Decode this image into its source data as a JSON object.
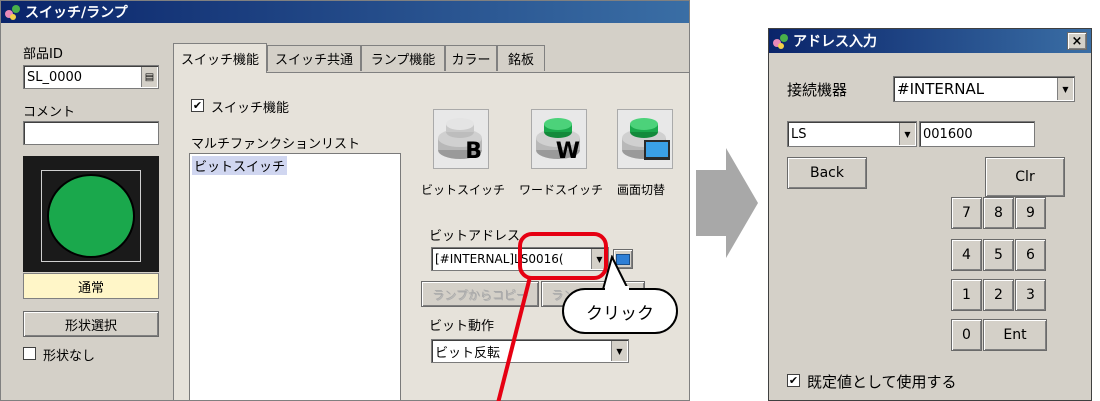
{
  "left_window": {
    "title": "スイッチ/ランプ",
    "part_id_label": "部品ID",
    "part_id_value": "SL_0000",
    "comment_label": "コメント",
    "comment_value": "",
    "preview_state": "通常",
    "shape_select_button": "形状選択",
    "no_shape_label": "形状なし",
    "no_shape_checked": false,
    "tabs": [
      {
        "label": "スイッチ機能",
        "active": true
      },
      {
        "label": "スイッチ共通",
        "active": false
      },
      {
        "label": "ランプ機能",
        "active": false
      },
      {
        "label": "カラー",
        "active": false
      },
      {
        "label": "銘板",
        "active": false
      }
    ],
    "switch_function_label": "スイッチ機能",
    "switch_function_checked": true,
    "multifunction_list_label": "マルチファンクションリスト",
    "multifunction_list_items": [
      "ビットスイッチ"
    ],
    "switch_types": [
      {
        "label": "ビットスイッチ",
        "letter": "B",
        "icon": "bit-switch-icon"
      },
      {
        "label": "ワードスイッチ",
        "letter": "W",
        "icon": "word-switch-icon"
      },
      {
        "label": "画面切替",
        "letter": "",
        "icon": "screen-change-icon"
      }
    ],
    "bit_address_label": "ビットアドレス",
    "bit_address_value": "[#INTERNAL]LS0016(",
    "copy_from_lamp_button": "ランプからコピー",
    "copy_to_lamp_button": "ランプへコピー",
    "bit_action_label": "ビット動作",
    "bit_action_value": "ビット反転"
  },
  "callout_text": "クリック",
  "right_window": {
    "title": "アドレス入力",
    "close_symbol": "×",
    "device_label": "接続機器",
    "device_value": "#INTERNAL",
    "address_type_value": "LS",
    "address_value": "001600",
    "back_button": "Back",
    "clr_button": "Clr",
    "keys": [
      "7",
      "8",
      "9",
      "4",
      "5",
      "6",
      "1",
      "2",
      "3"
    ],
    "zero_key": "0",
    "ent_key": "Ent",
    "default_checkbox_label": "既定値として使用する",
    "default_checked": true
  },
  "colors": {
    "lamp_green": "#1aa84c",
    "highlight_red": "#e60012",
    "arrow_gray": "#a8a8a8"
  }
}
